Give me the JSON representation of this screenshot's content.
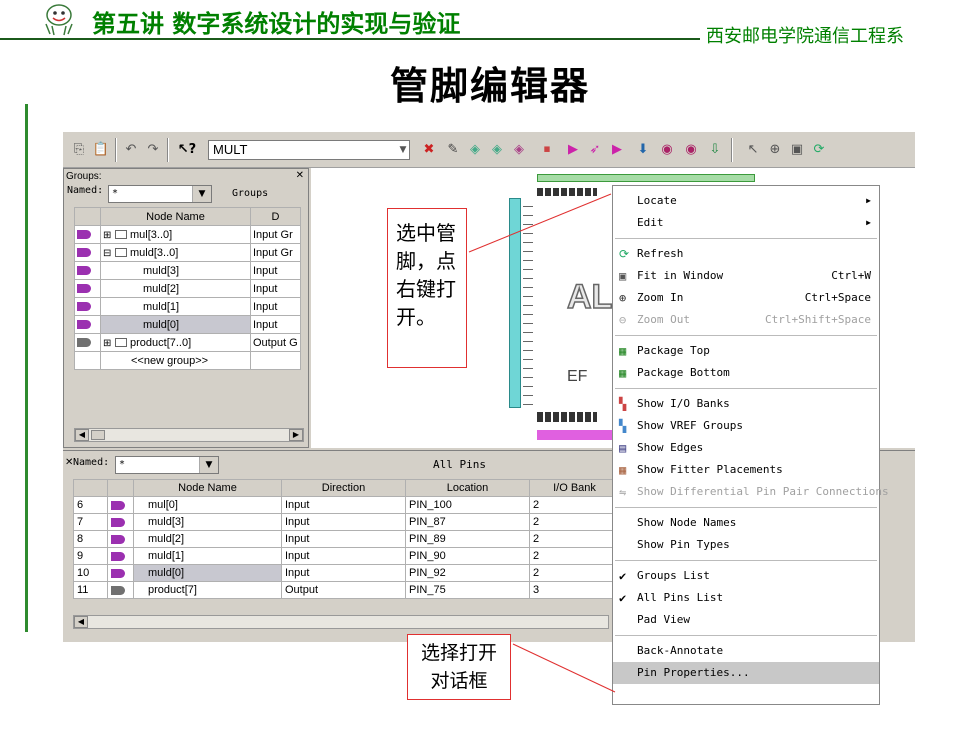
{
  "header": {
    "title": "第五讲 数字系统设计的实现与验证",
    "org": "西安邮电学院通信工程系",
    "slide_title": "管脚编辑器"
  },
  "toolbar": {
    "combo_value": "MULT"
  },
  "groups_panel": {
    "caption": "Groups:",
    "named_label": "Named:",
    "named_value": "*",
    "header_right": "Groups",
    "columns": [
      "Node Name",
      "D"
    ],
    "rows": [
      {
        "name": "mul[3..0]",
        "dir": "Input Gr"
      },
      {
        "name": "muld[3..0]",
        "dir": "Input Gr"
      },
      {
        "name": "muld[3]",
        "dir": "Input"
      },
      {
        "name": "muld[2]",
        "dir": "Input"
      },
      {
        "name": "muld[1]",
        "dir": "Input"
      },
      {
        "name": "muld[0]",
        "dir": "Input"
      },
      {
        "name": "product[7..0]",
        "dir": "Output G"
      },
      {
        "name": "<<new group>>",
        "dir": ""
      }
    ]
  },
  "chip": {
    "callout": [
      "选中管",
      "脚，点",
      "右键打",
      "开。"
    ],
    "logo": "AL",
    "device_prefix": "EF"
  },
  "pins_panel": {
    "named_label": "Named:",
    "named_value": "*",
    "title": "All Pins",
    "columns": [
      "",
      "",
      "Node Name",
      "Direction",
      "Location",
      "I/O Bank"
    ],
    "rows": [
      {
        "num": "6",
        "name": "mul[0]",
        "dir": "Input",
        "loc": "PIN_100",
        "bank": "2"
      },
      {
        "num": "7",
        "name": "muld[3]",
        "dir": "Input",
        "loc": "PIN_87",
        "bank": "2"
      },
      {
        "num": "8",
        "name": "muld[2]",
        "dir": "Input",
        "loc": "PIN_89",
        "bank": "2"
      },
      {
        "num": "9",
        "name": "muld[1]",
        "dir": "Input",
        "loc": "PIN_90",
        "bank": "2"
      },
      {
        "num": "10",
        "name": "muld[0]",
        "dir": "Input",
        "loc": "PIN_92",
        "bank": "2"
      },
      {
        "num": "11",
        "name": "product[7]",
        "dir": "Output",
        "loc": "PIN_75",
        "bank": "3"
      }
    ]
  },
  "context_menu": {
    "items": [
      {
        "label": "Locate",
        "submenu": true
      },
      {
        "label": "Edit",
        "submenu": true
      },
      {
        "label": "Refresh",
        "icon": "refresh-icon"
      },
      {
        "label": "Fit in Window",
        "shortcut": "Ctrl+W",
        "icon": "fit-window-icon"
      },
      {
        "label": "Zoom In",
        "shortcut": "Ctrl+Space",
        "icon": "zoom-in-icon"
      },
      {
        "label": "Zoom Out",
        "shortcut": "Ctrl+Shift+Space",
        "icon": "zoom-out-icon",
        "disabled": true
      },
      {
        "label": "Package Top",
        "icon": "package-top-icon"
      },
      {
        "label": "Package Bottom",
        "icon": "package-bottom-icon"
      },
      {
        "label": "Show I/O Banks",
        "icon": "io-banks-icon"
      },
      {
        "label": "Show VREF Groups",
        "icon": "vref-groups-icon"
      },
      {
        "label": "Show Edges",
        "icon": "edges-icon"
      },
      {
        "label": "Show Fitter Placements",
        "icon": "fitter-placements-icon"
      },
      {
        "label": "Show Differential Pin Pair Connections",
        "icon": "diff-pin-icon",
        "disabled": true
      },
      {
        "label": "Show Node Names"
      },
      {
        "label": "Show Pin Types"
      },
      {
        "label": "Groups List",
        "checked": true
      },
      {
        "label": "All Pins List",
        "checked": true
      },
      {
        "label": "Pad View"
      },
      {
        "label": "Back-Annotate"
      },
      {
        "label": "Pin Properties...",
        "highlighted": true
      }
    ]
  },
  "bottom_callout": [
    "选择打开",
    "对话框"
  ],
  "colors": {
    "title_green": "#008000",
    "callout_red": "#e03030",
    "menu_highlight": "#c8c8c8"
  }
}
